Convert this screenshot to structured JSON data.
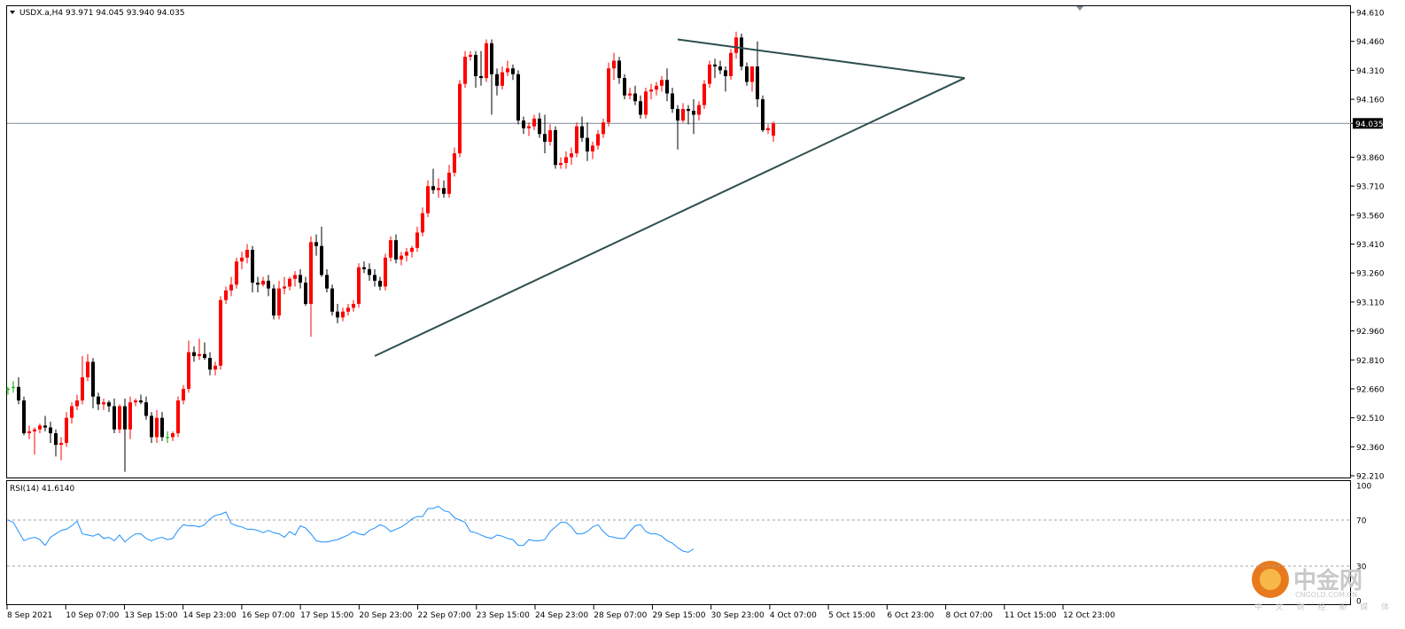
{
  "header": {
    "symbol_line": "USDX.a,H4  93.971 94.045 93.940 94.035",
    "rsi_line": "RSI(14) 41.6140"
  },
  "current_price_label": "94.035",
  "watermark": {
    "brand": "中金网",
    "url": "CNGOLD.COM.CN",
    "slogan": "中 文 财 经 新 媒 体"
  },
  "colors": {
    "bull": "#ff0000",
    "bear": "#000000",
    "doji": "#00a000",
    "trendline": "#2f4f4f",
    "rsi": "#1e90ff",
    "price_line": "#7a8a99",
    "label_bg": "#000000"
  },
  "chart_data": [
    {
      "type": "candlestick",
      "symbol": "USDX.a",
      "timeframe": "H4",
      "ohlc_header": {
        "open": 93.971,
        "high": 94.045,
        "low": 93.94,
        "close": 94.035
      },
      "ylim": [
        92.21,
        94.61
      ],
      "yticks": [
        "94.610",
        "94.460",
        "94.310",
        "94.160",
        "94.035",
        "93.860",
        "93.710",
        "93.560",
        "93.410",
        "93.260",
        "93.110",
        "92.960",
        "92.810",
        "92.660",
        "92.510",
        "92.360",
        "92.210"
      ],
      "xticks": [
        "8 Sep 2021",
        "10 Sep 07:00",
        "13 Sep 15:00",
        "14 Sep 23:00",
        "16 Sep 07:00",
        "17 Sep 15:00",
        "20 Sep 23:00",
        "22 Sep 07:00",
        "23 Sep 15:00",
        "24 Sep 23:00",
        "28 Sep 07:00",
        "29 Sep 15:00",
        "30 Sep 23:00",
        "4 Oct 07:00",
        "5 Oct 15:00",
        "6 Oct 23:00",
        "8 Oct 07:00",
        "11 Oct 15:00",
        "12 Oct 23:00"
      ],
      "current_price": 94.035,
      "candles": [
        [
          92.66,
          92.67,
          92.63,
          92.66
        ],
        [
          92.67,
          92.7,
          92.64,
          92.67
        ],
        [
          92.67,
          92.72,
          92.58,
          92.6
        ],
        [
          92.6,
          92.62,
          92.42,
          92.43
        ],
        [
          92.43,
          92.47,
          92.4,
          92.44
        ],
        [
          92.44,
          92.46,
          92.32,
          92.45
        ],
        [
          92.45,
          92.48,
          92.43,
          92.47
        ],
        [
          92.47,
          92.52,
          92.44,
          92.46
        ],
        [
          92.46,
          92.49,
          92.38,
          92.43
        ],
        [
          92.43,
          92.45,
          92.31,
          92.37
        ],
        [
          92.37,
          92.41,
          92.29,
          92.38
        ],
        [
          92.38,
          92.54,
          92.36,
          92.51
        ],
        [
          92.51,
          92.59,
          92.48,
          92.57
        ],
        [
          92.57,
          92.63,
          92.55,
          92.6
        ],
        [
          92.6,
          92.83,
          92.58,
          92.72
        ],
        [
          92.72,
          92.84,
          92.7,
          92.8
        ],
        [
          92.8,
          92.82,
          92.56,
          92.62
        ],
        [
          92.62,
          92.64,
          92.55,
          92.58
        ],
        [
          92.58,
          92.61,
          92.55,
          92.59
        ],
        [
          92.59,
          92.6,
          92.54,
          92.57
        ],
        [
          92.57,
          92.61,
          92.43,
          92.45
        ],
        [
          92.45,
          92.58,
          92.43,
          92.57
        ],
        [
          92.57,
          92.61,
          92.23,
          92.45
        ],
        [
          92.45,
          92.62,
          92.4,
          92.59
        ],
        [
          92.59,
          92.61,
          92.57,
          92.6
        ],
        [
          92.6,
          92.63,
          92.58,
          92.59
        ],
        [
          92.59,
          92.62,
          92.5,
          92.52
        ],
        [
          92.52,
          92.54,
          92.38,
          92.41
        ],
        [
          92.41,
          92.55,
          92.38,
          92.51
        ],
        [
          92.51,
          92.54,
          92.39,
          92.41
        ],
        [
          92.41,
          92.44,
          92.38,
          92.41
        ],
        [
          92.41,
          92.44,
          92.39,
          92.43
        ],
        [
          92.43,
          92.62,
          92.41,
          92.6
        ],
        [
          92.6,
          92.68,
          92.58,
          92.66
        ],
        [
          92.66,
          92.91,
          92.64,
          92.85
        ],
        [
          92.85,
          92.88,
          92.8,
          92.83
        ],
        [
          92.83,
          92.92,
          92.81,
          92.84
        ],
        [
          92.84,
          92.9,
          92.81,
          92.82
        ],
        [
          92.82,
          92.85,
          92.73,
          92.76
        ],
        [
          92.76,
          92.8,
          92.73,
          92.78
        ],
        [
          92.78,
          93.14,
          92.76,
          93.12
        ],
        [
          93.12,
          93.19,
          93.1,
          93.17
        ],
        [
          93.17,
          93.24,
          93.14,
          93.2
        ],
        [
          93.2,
          93.34,
          93.18,
          93.32
        ],
        [
          93.32,
          93.37,
          93.28,
          93.34
        ],
        [
          93.34,
          93.41,
          93.31,
          93.38
        ],
        [
          93.38,
          93.4,
          93.16,
          93.21
        ],
        [
          93.21,
          93.24,
          93.16,
          93.2
        ],
        [
          93.2,
          93.24,
          93.19,
          93.22
        ],
        [
          93.22,
          93.25,
          93.14,
          93.18
        ],
        [
          93.18,
          93.2,
          93.02,
          93.04
        ],
        [
          93.04,
          93.22,
          93.02,
          93.18
        ],
        [
          93.18,
          93.24,
          93.15,
          93.19
        ],
        [
          93.19,
          93.24,
          93.17,
          93.23
        ],
        [
          93.23,
          93.27,
          93.19,
          93.25
        ],
        [
          93.25,
          93.28,
          93.18,
          93.21
        ],
        [
          93.21,
          93.24,
          93.09,
          93.1
        ],
        [
          93.1,
          93.45,
          92.93,
          93.42
        ],
        [
          93.42,
          93.46,
          93.35,
          93.4
        ],
        [
          93.4,
          93.5,
          93.24,
          93.25
        ],
        [
          93.25,
          93.28,
          93.16,
          93.18
        ],
        [
          93.18,
          93.2,
          93.04,
          93.06
        ],
        [
          93.06,
          93.1,
          93.0,
          93.03
        ],
        [
          93.03,
          93.08,
          93.01,
          93.06
        ],
        [
          93.06,
          93.1,
          93.04,
          93.08
        ],
        [
          93.08,
          93.12,
          93.06,
          93.1
        ],
        [
          93.1,
          93.31,
          93.08,
          93.29
        ],
        [
          93.29,
          93.32,
          93.26,
          93.28
        ],
        [
          93.28,
          93.31,
          93.22,
          93.25
        ],
        [
          93.25,
          93.28,
          93.19,
          93.22
        ],
        [
          93.22,
          93.24,
          93.17,
          93.19
        ],
        [
          93.19,
          93.36,
          93.17,
          93.34
        ],
        [
          93.34,
          93.45,
          93.32,
          93.43
        ],
        [
          93.43,
          93.46,
          93.31,
          93.33
        ],
        [
          93.33,
          93.37,
          93.3,
          93.35
        ],
        [
          93.35,
          93.39,
          93.32,
          93.37
        ],
        [
          93.37,
          93.4,
          93.34,
          93.39
        ],
        [
          93.39,
          93.5,
          93.37,
          93.47
        ],
        [
          93.47,
          93.6,
          93.45,
          93.57
        ],
        [
          93.57,
          93.74,
          93.55,
          93.71
        ],
        [
          93.71,
          93.8,
          93.67,
          93.69
        ],
        [
          93.69,
          93.75,
          93.65,
          93.7
        ],
        [
          93.7,
          93.74,
          93.65,
          93.67
        ],
        [
          93.67,
          93.82,
          93.65,
          93.78
        ],
        [
          93.78,
          93.91,
          93.76,
          93.88
        ],
        [
          93.88,
          94.26,
          93.86,
          94.24
        ],
        [
          94.24,
          94.41,
          94.22,
          94.38
        ],
        [
          94.38,
          94.41,
          94.36,
          94.39
        ],
        [
          94.39,
          94.41,
          94.22,
          94.28
        ],
        [
          94.28,
          94.41,
          94.23,
          94.27
        ],
        [
          94.27,
          94.47,
          94.25,
          94.45
        ],
        [
          94.45,
          94.47,
          94.08,
          94.29
        ],
        [
          94.29,
          94.32,
          94.18,
          94.23
        ],
        [
          94.23,
          94.33,
          94.21,
          94.3
        ],
        [
          94.3,
          94.36,
          94.28,
          94.32
        ],
        [
          94.32,
          94.34,
          94.26,
          94.29
        ],
        [
          94.29,
          94.31,
          94.03,
          94.05
        ],
        [
          94.05,
          94.07,
          93.98,
          94.01
        ],
        [
          94.01,
          94.04,
          93.97,
          94.02
        ],
        [
          94.02,
          94.08,
          94.0,
          94.06
        ],
        [
          94.06,
          94.09,
          93.96,
          93.98
        ],
        [
          93.98,
          94.08,
          93.88,
          93.94
        ],
        [
          93.94,
          94.03,
          93.92,
          94.0
        ],
        [
          94.0,
          94.02,
          93.8,
          93.82
        ],
        [
          93.82,
          93.86,
          93.8,
          93.83
        ],
        [
          93.83,
          93.89,
          93.8,
          93.86
        ],
        [
          93.86,
          93.91,
          93.82,
          93.88
        ],
        [
          93.88,
          94.04,
          93.86,
          94.02
        ],
        [
          94.02,
          94.07,
          93.94,
          93.96
        ],
        [
          93.96,
          94.04,
          93.84,
          93.89
        ],
        [
          93.89,
          93.94,
          93.85,
          93.92
        ],
        [
          93.92,
          94.0,
          93.9,
          93.98
        ],
        [
          93.98,
          94.06,
          93.96,
          94.04
        ],
        [
          94.04,
          94.35,
          94.02,
          94.32
        ],
        [
          94.32,
          94.4,
          94.26,
          94.36
        ],
        [
          94.36,
          94.38,
          94.24,
          94.27
        ],
        [
          94.27,
          94.29,
          94.16,
          94.18
        ],
        [
          94.18,
          94.22,
          94.16,
          94.19
        ],
        [
          94.19,
          94.23,
          94.13,
          94.15
        ],
        [
          94.15,
          94.18,
          94.06,
          94.08
        ],
        [
          94.08,
          94.22,
          94.06,
          94.2
        ],
        [
          94.2,
          94.24,
          94.16,
          94.21
        ],
        [
          94.21,
          94.25,
          94.18,
          94.23
        ],
        [
          94.23,
          94.28,
          94.2,
          94.26
        ],
        [
          94.26,
          94.32,
          94.15,
          94.19
        ],
        [
          94.19,
          94.22,
          94.09,
          94.11
        ],
        [
          94.11,
          94.13,
          93.9,
          94.05
        ],
        [
          94.05,
          94.14,
          94.04,
          94.11
        ],
        [
          94.11,
          94.13,
          94.03,
          94.1
        ],
        [
          94.1,
          94.16,
          93.98,
          94.08
        ],
        [
          94.08,
          94.15,
          94.05,
          94.13
        ],
        [
          94.13,
          94.26,
          94.11,
          94.24
        ],
        [
          94.24,
          94.36,
          94.22,
          94.34
        ],
        [
          94.34,
          94.37,
          94.27,
          94.33
        ],
        [
          94.33,
          94.36,
          94.29,
          94.31
        ],
        [
          94.31,
          94.33,
          94.2,
          94.28
        ],
        [
          94.28,
          94.42,
          94.26,
          94.4
        ],
        [
          94.4,
          94.51,
          94.37,
          94.48
        ],
        [
          94.48,
          94.5,
          94.31,
          94.33
        ],
        [
          94.33,
          94.35,
          94.23,
          94.25
        ],
        [
          94.25,
          94.3,
          94.2,
          94.33
        ],
        [
          94.33,
          94.46,
          94.12,
          94.16
        ],
        [
          94.16,
          94.18,
          93.99,
          94.0
        ],
        [
          94.0,
          94.03,
          93.98,
          94.01
        ],
        [
          93.971,
          94.045,
          93.94,
          94.035
        ]
      ],
      "trendlines": [
        {
          "name": "upper-trendline",
          "from": [
            126,
            94.47
          ],
          "to": [
            180,
            94.27
          ]
        },
        {
          "name": "lower-trendline",
          "from": [
            69,
            92.83
          ],
          "to": [
            180,
            94.27
          ]
        }
      ]
    },
    {
      "type": "line",
      "name": "RSI(14)",
      "last_value": 41.614,
      "ylim": [
        0,
        100
      ],
      "yticks": [
        "100",
        "70",
        "30",
        "0"
      ],
      "levels": [
        70,
        30
      ],
      "values": [
        70,
        68,
        60,
        52,
        54,
        55,
        53,
        48,
        55,
        58,
        61,
        62,
        65,
        69,
        58,
        57,
        56,
        58,
        54,
        55,
        52,
        57,
        51,
        55,
        58,
        58,
        54,
        52,
        54,
        55,
        53,
        54,
        61,
        66,
        65,
        65,
        64,
        66,
        71,
        74,
        75,
        77,
        67,
        65,
        64,
        62,
        62,
        61,
        59,
        61,
        59,
        58,
        55,
        60,
        57,
        65,
        63,
        58,
        52,
        51,
        51,
        52,
        53,
        55,
        57,
        60,
        58,
        57,
        61,
        63,
        66,
        64,
        60,
        62,
        64,
        67,
        71,
        73,
        73,
        80,
        80,
        82,
        78,
        77,
        72,
        70,
        68,
        60,
        59,
        57,
        55,
        54,
        57,
        56,
        54,
        53,
        48,
        48,
        53,
        52,
        52,
        53,
        60,
        64,
        68,
        68,
        64,
        58,
        58,
        60,
        64,
        66,
        60,
        56,
        55,
        54,
        54,
        60,
        65,
        66,
        60,
        58,
        58,
        56,
        52,
        50,
        46,
        43,
        42,
        45
      ]
    }
  ]
}
